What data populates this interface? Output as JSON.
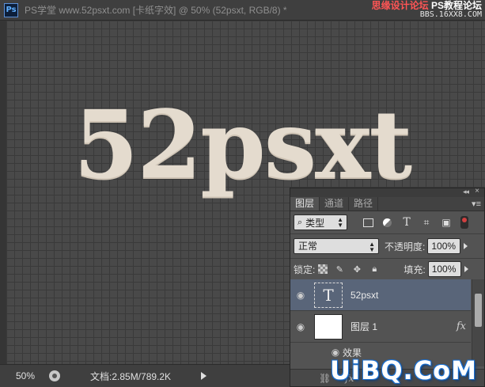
{
  "window": {
    "app_logo": "Ps",
    "document_title": "PS学堂 www.52psxt.com [卡纸字效] @ 50% (52psxt, RGB/8) *"
  },
  "watermark_top": {
    "line1_left": "思缘设计论坛",
    "line1_right": "PS教程论坛",
    "line2": "BBS.16XX8.COM"
  },
  "canvas": {
    "text": "52psxt",
    "text_color": "#e4dbce",
    "background_color": "#494949"
  },
  "statusbar": {
    "zoom": "50%",
    "doc_info": "文档:2.85M/789.2K"
  },
  "layers_panel": {
    "tabs": [
      {
        "label": "图层",
        "active": true
      },
      {
        "label": "通道",
        "active": false
      },
      {
        "label": "路径",
        "active": false
      }
    ],
    "filter": {
      "kind_label": "类型",
      "icons": [
        "image-filter-icon",
        "adjustment-filter-icon",
        "type-filter-icon",
        "shape-filter-icon",
        "smart-object-filter-icon"
      ]
    },
    "blend_mode": "正常",
    "opacity_label": "不透明度:",
    "opacity_value": "100%",
    "lock_label": "锁定:",
    "lock_icons": [
      "lock-transparent-icon",
      "lock-brush-icon",
      "lock-move-icon",
      "lock-all-icon"
    ],
    "fill_label": "填充:",
    "fill_value": "100%",
    "layers": [
      {
        "name": "52psxt",
        "type": "text",
        "thumb_glyph": "T",
        "selected": true,
        "visible": true
      },
      {
        "name": "图层 1",
        "type": "pixel",
        "selected": false,
        "visible": true,
        "fx": "fx"
      }
    ],
    "effects_label": "效果",
    "bottom_icons": [
      "link-icon",
      "fx-icon"
    ],
    "bottom_fx": "fx"
  },
  "watermark_corner": "UiBQ.CoM",
  "colors": {
    "selected_layer": "#596579",
    "panel_bg": "#535353",
    "ps_blue": "#5fb0ff"
  }
}
